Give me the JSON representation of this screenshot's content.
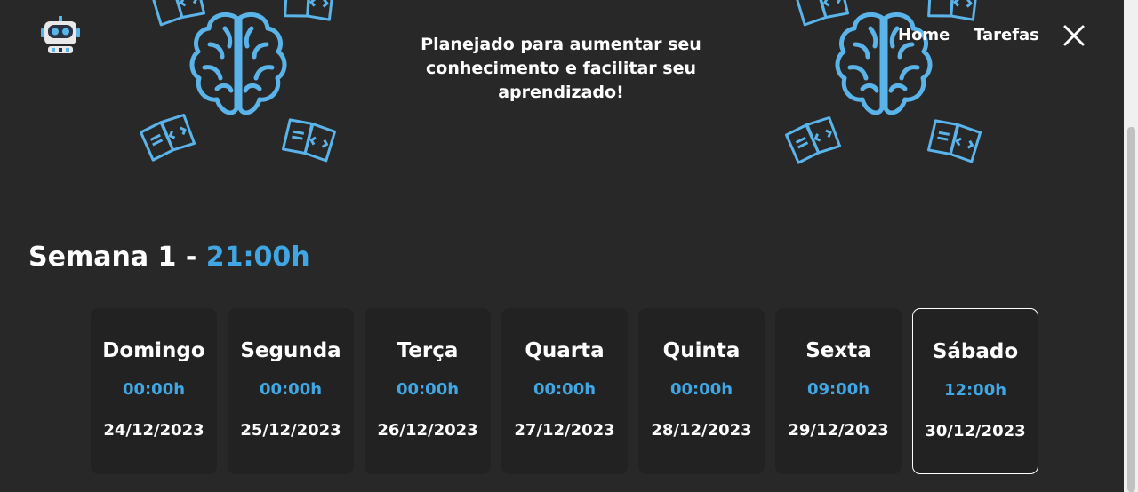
{
  "header": {
    "logo_icon": "robot-icon",
    "tagline": "Planejado para aumentar seu conhecimento e facilitar seu aprendizado!",
    "nav": [
      {
        "label": "Home"
      },
      {
        "label": "Tarefas"
      }
    ],
    "close_icon": "close-icon"
  },
  "decorations": {
    "brain_icon": "brain-icon",
    "book_icon": "code-book-icon"
  },
  "week": {
    "title": "Semana 1",
    "separator": "-",
    "total_hours": "21:00h"
  },
  "days": [
    {
      "name": "Domingo",
      "hours": "00:00h",
      "date": "24/12/2023"
    },
    {
      "name": "Segunda",
      "hours": "00:00h",
      "date": "25/12/2023"
    },
    {
      "name": "Terça",
      "hours": "00:00h",
      "date": "26/12/2023"
    },
    {
      "name": "Quarta",
      "hours": "00:00h",
      "date": "27/12/2023"
    },
    {
      "name": "Quinta",
      "hours": "00:00h",
      "date": "28/12/2023"
    },
    {
      "name": "Sexta",
      "hours": "09:00h",
      "date": "29/12/2023"
    },
    {
      "name": "Sábado",
      "hours": "12:00h",
      "date": "30/12/2023",
      "selected": true
    }
  ],
  "colors": {
    "background": "#282828",
    "card": "#222222",
    "accent": "#41a7e4",
    "text": "#ffffff"
  }
}
